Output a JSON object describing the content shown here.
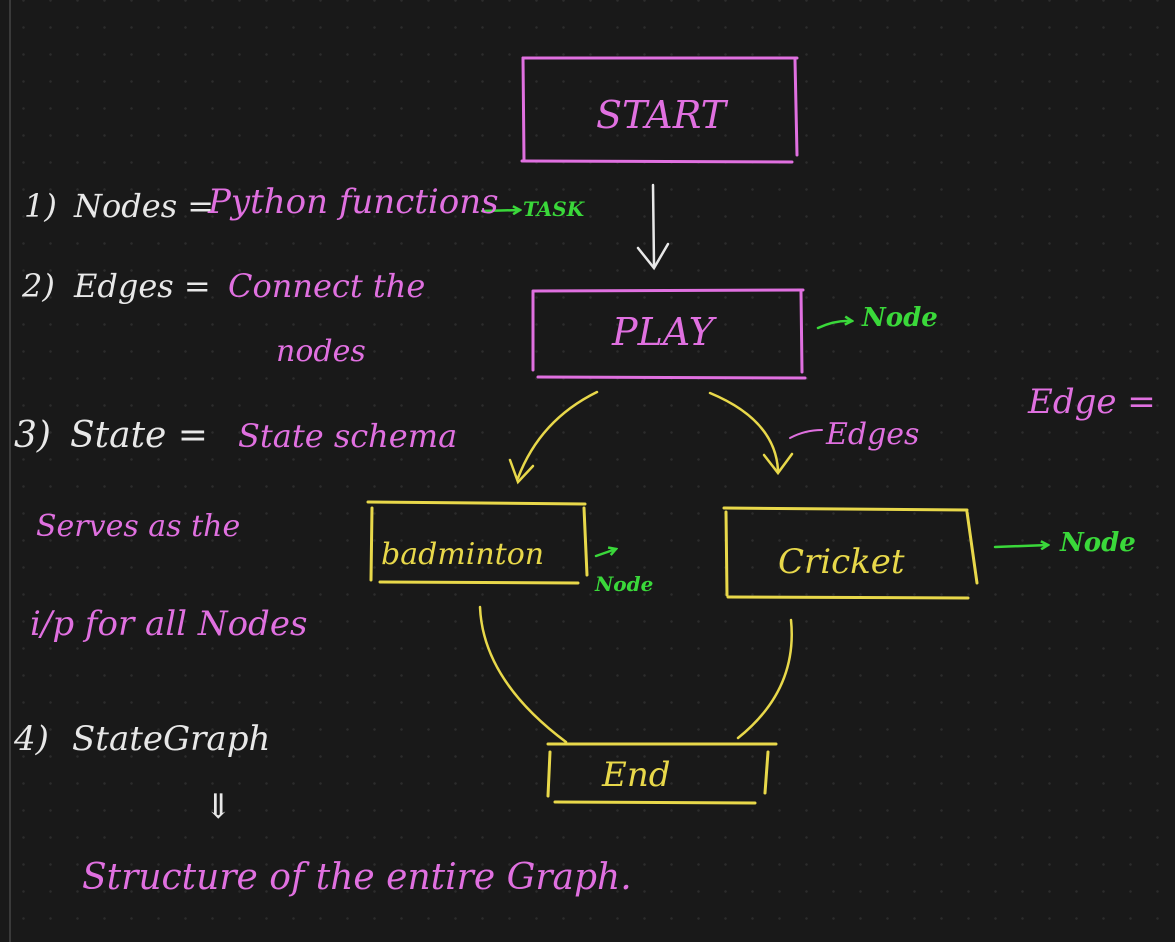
{
  "colors": {
    "background": "#191919",
    "white_ink": "#e8e8e8",
    "pink_ink": "#e070e0",
    "green_ink": "#3ad83a",
    "yellow_ink": "#e8e84a"
  },
  "notes": {
    "n1_num": "1)",
    "n1_term": "Nodes =",
    "n1_def": "Python functions",
    "n1_arrow_label": "TASK",
    "n2_num": "2)",
    "n2_term": "Edges =",
    "n2_def_line1": "Connect the",
    "n2_def_line2": "nodes",
    "n3_num": "3)",
    "n3_term": "State =",
    "n3_def": "State schema",
    "n3_line2": "Serves as the",
    "n3_line3": "i/p for all Nodes",
    "n4_num": "4)",
    "n4_term": "StateGraph",
    "n4_arrow": "⇓",
    "n4_def": "Structure of the entire Graph."
  },
  "diagram": {
    "start": "START",
    "play": "PLAY",
    "badminton": "badminton",
    "cricket": "Cricket",
    "end": "End",
    "play_tag": "Node",
    "badminton_tag": "Node",
    "cricket_tag": "Node",
    "edge_tag": "Edges",
    "edge_eq": "Edge ="
  }
}
